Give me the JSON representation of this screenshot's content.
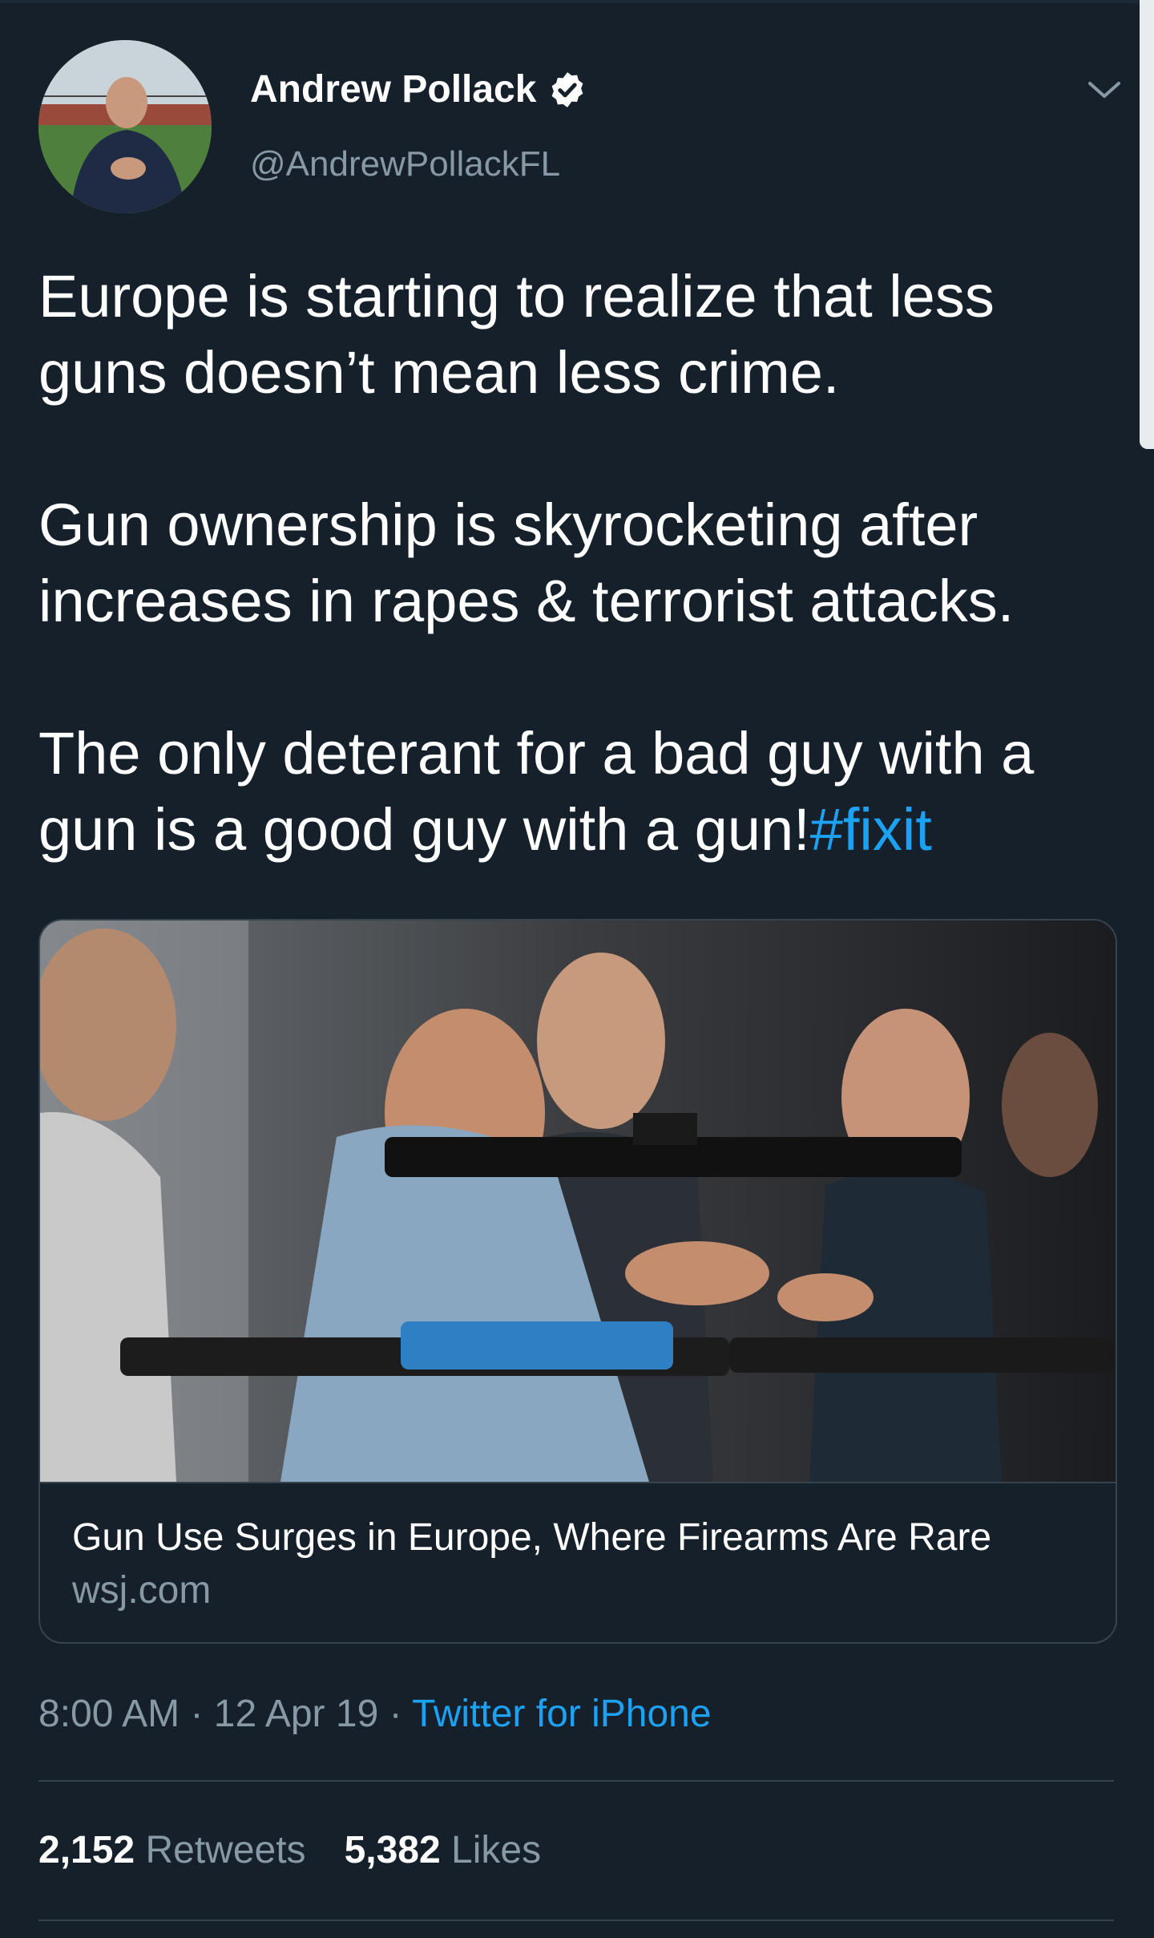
{
  "tweet": {
    "author_name": "Andrew Pollack",
    "handle": "@AndrewPollackFL",
    "verified": true,
    "text_p1": "Europe is starting to realize that less guns doesn’t mean less crime.",
    "text_p2": "Gun ownership is skyrocketing after increases in rapes & terrorist attacks.",
    "text_p3": "The only deterant for a bad guy with a gun is a good guy with a gun!",
    "hashtag": "#fixit"
  },
  "card": {
    "title": "Gun Use Surges in Europe, Where Firearms Are Rare",
    "domain": "wsj.com"
  },
  "meta": {
    "time": "8:00 AM",
    "separator": " · ",
    "date": "12 Apr 19",
    "source": "Twitter for iPhone"
  },
  "stats": {
    "retweets_count": "2,152",
    "retweets_label": "Retweets",
    "likes_count": "5,382",
    "likes_label": "Likes"
  },
  "icons": {
    "verified": "verified-badge-icon",
    "caret": "chevron-down-icon"
  },
  "colors": {
    "background": "#15202b",
    "accent": "#1da1f2",
    "secondary_text": "#8899a6",
    "border": "#38444d"
  }
}
